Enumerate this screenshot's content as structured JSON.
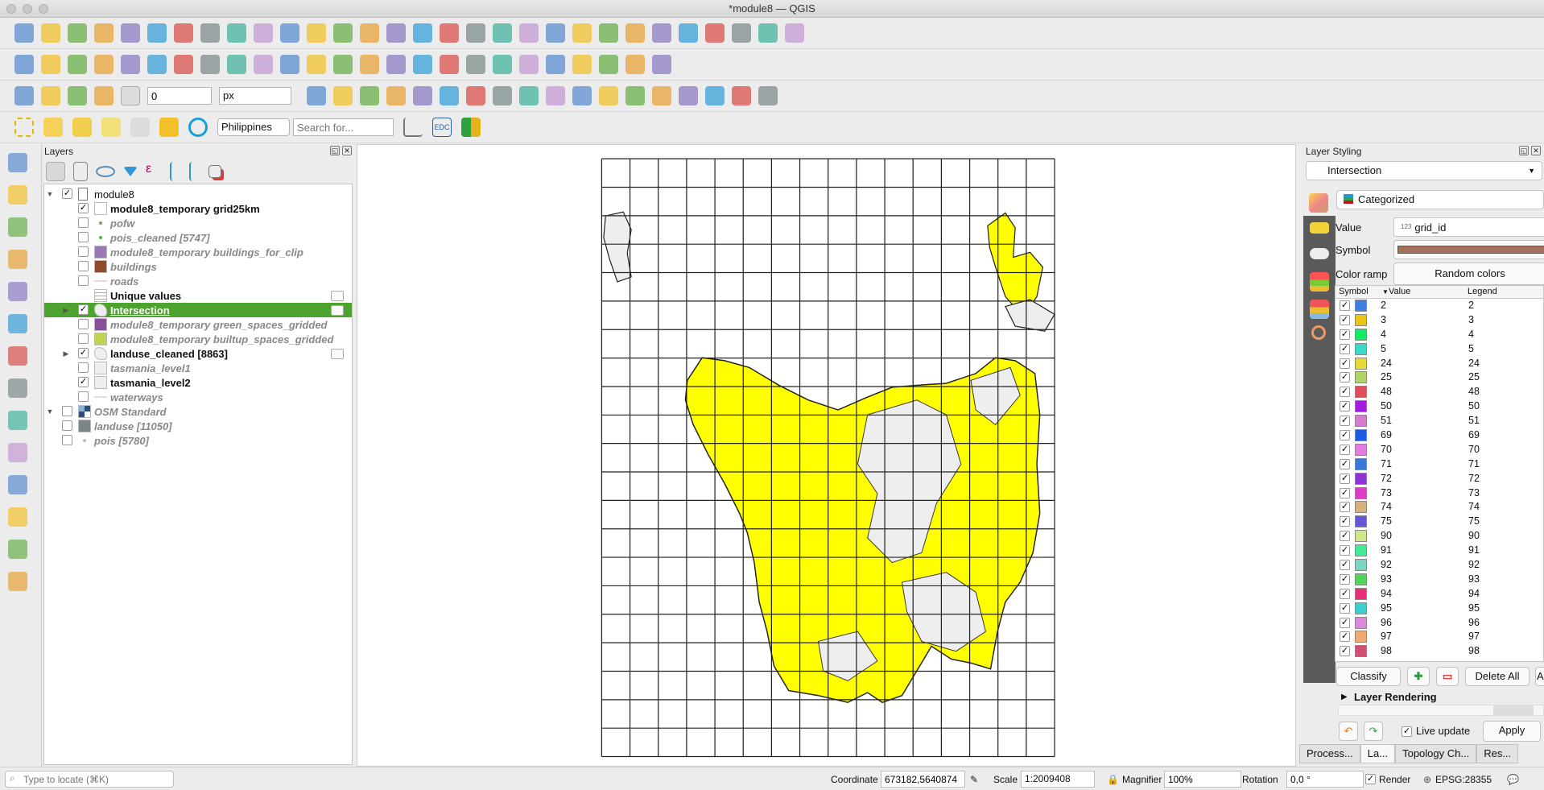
{
  "window": {
    "title": "*module8 — QGIS"
  },
  "toolbar": {
    "row1_icons": [
      "new-project",
      "open-project",
      "save-project",
      "save-as",
      "new-print-layout",
      "layout-manager",
      "pan",
      "pan-to-selection",
      "zoom-in",
      "zoom-out",
      "zoom-full",
      "zoom-to-selection",
      "zoom-to-layer",
      "zoom-native",
      "zoom-last",
      "zoom-next",
      "new-map-view",
      "new-3d-view",
      "new-bookmark",
      "show-bookmarks",
      "temporal",
      "refresh",
      "identify",
      "attribute-table",
      "statistics",
      "sum",
      "measure",
      "map-tips",
      "select",
      "text-annotation"
    ],
    "row2_icons": [
      "edit-pencil",
      "toggle-editing",
      "save-edits",
      "digitize",
      "delete",
      "cut",
      "copy",
      "paste",
      "undo",
      "redo",
      "add-vector",
      "add-raster",
      "vertex-tool",
      "add-feature",
      "label-tool",
      "pin-labels",
      "show-labels",
      "move-label",
      "rotate-label",
      "change-label",
      "database",
      "hexagon",
      "web-services",
      "plugin",
      "python"
    ],
    "row3_icons": [
      "trace",
      "advanced-digitize",
      "snap",
      "magnet"
    ],
    "snapping_tolerance": "0",
    "snapping_unit": "px",
    "locator_country": "Philippines",
    "search_placeholder": "Search for...",
    "edc_label": "EDC",
    "row3_right_icons": [
      "python-console",
      "grid",
      "world",
      "gps",
      "layers",
      "qgis-plugin",
      "triangulate",
      "refresh-plugin",
      "ref-plugin",
      "grid-plugin",
      "3d",
      "table",
      "pca",
      "binoculars",
      "info",
      "photo",
      "openeo",
      "map"
    ]
  },
  "left_toolbar": [
    "new-vector-layer",
    "add-xyz-layer",
    "add-mesh-layer",
    "add-delimited-text",
    "add-spatialite",
    "add-virtual-layer",
    "add-postgis",
    "add-wms",
    "add-wfs",
    "add-wcs",
    "add-geopackage",
    "gps-tool",
    "georeferencer",
    "crosshair"
  ],
  "layers_panel": {
    "title": "Layers",
    "items": [
      {
        "label": "module8",
        "level": 0,
        "checked": true,
        "expander": "down",
        "style": "normal",
        "swatch": "group"
      },
      {
        "label": "module8_temporary grid25km",
        "level": 1,
        "checked": true,
        "style": "bold",
        "swatch": "#ffffff"
      },
      {
        "label": "pofw",
        "level": 1,
        "checked": false,
        "style": "italic",
        "swatch": "dot",
        "dot_color": "#7aa06a"
      },
      {
        "label": "pois_cleaned [5747]",
        "level": 1,
        "checked": false,
        "style": "italic",
        "swatch": "dot",
        "dot_color": "#4bb34b"
      },
      {
        "label": "module8_temporary buildings_for_clip",
        "level": 1,
        "checked": false,
        "style": "italic",
        "swatch": "#9b79b7"
      },
      {
        "label": "buildings",
        "level": 1,
        "checked": false,
        "style": "italic",
        "swatch": "#8e4a2b"
      },
      {
        "label": "roads",
        "level": 1,
        "checked": false,
        "style": "italic",
        "swatch": "line",
        "line_color": "#e8d8cf"
      },
      {
        "label": "Unique values",
        "level": 1,
        "checked": null,
        "style": "bold",
        "swatch": "table",
        "right_icon": "embedded"
      },
      {
        "label": "Intersection",
        "level": 1,
        "checked": true,
        "expander": "right",
        "style": "selected",
        "swatch": "polygon",
        "right_icon": "embedded"
      },
      {
        "label": "module8_temporary green_spaces_gridded",
        "level": 1,
        "checked": false,
        "style": "italic",
        "swatch": "#8a4f9a"
      },
      {
        "label": "module8_temporary builtup_spaces_gridded",
        "level": 1,
        "checked": false,
        "style": "italic",
        "swatch": "#c3d152"
      },
      {
        "label": "landuse_cleaned [8863]",
        "level": 1,
        "checked": true,
        "expander": "right",
        "style": "bold",
        "swatch": "polygon",
        "right_icon": "filter"
      },
      {
        "label": "tasmania_level1",
        "level": 1,
        "checked": false,
        "style": "italic",
        "swatch": "#eeeeee"
      },
      {
        "label": "tasmania_level2",
        "level": 1,
        "checked": true,
        "style": "bold",
        "swatch": "#eeeeee"
      },
      {
        "label": "waterways",
        "level": 1,
        "checked": false,
        "style": "italic",
        "swatch": "line",
        "line_color": "#e6d8e6"
      },
      {
        "label": "OSM Standard",
        "level": 0,
        "checked": false,
        "expander": "down",
        "style": "italic",
        "swatch": "raster"
      },
      {
        "label": "landuse [11050]",
        "level": 0,
        "checked": false,
        "style": "italic",
        "swatch": "#7b858a"
      },
      {
        "label": "pois [5780]",
        "level": 0,
        "checked": false,
        "style": "italic",
        "swatch": "dot",
        "dot_color": "#bbbbbb"
      }
    ]
  },
  "map": {
    "grid_columns": 16,
    "grid_rows": 21,
    "land_color": "#ffff00",
    "other_color": "#eeeeee"
  },
  "layer_styling": {
    "title": "Layer Styling",
    "layer": "Intersection",
    "renderer": "Categorized",
    "value_label": "Value",
    "value_type": "123",
    "value": "grid_id",
    "symbol_label": "Symbol",
    "symbol_color": "#a3705a",
    "color_ramp_label": "Color ramp",
    "color_ramp": "Random colors",
    "columns": [
      "Symbol",
      "Value",
      "Legend"
    ],
    "categories": [
      {
        "value": "2",
        "legend": "2",
        "color": "#3f7fe0"
      },
      {
        "value": "3",
        "legend": "3",
        "color": "#ecc31b"
      },
      {
        "value": "4",
        "legend": "4",
        "color": "#14ea62"
      },
      {
        "value": "5",
        "legend": "5",
        "color": "#3bdac6"
      },
      {
        "value": "24",
        "legend": "24",
        "color": "#e6d93a"
      },
      {
        "value": "25",
        "legend": "25",
        "color": "#acd46a"
      },
      {
        "value": "48",
        "legend": "48",
        "color": "#e04e5c"
      },
      {
        "value": "50",
        "legend": "50",
        "color": "#a31be0"
      },
      {
        "value": "51",
        "legend": "51",
        "color": "#d37ecc"
      },
      {
        "value": "69",
        "legend": "69",
        "color": "#1d5ae0"
      },
      {
        "value": "70",
        "legend": "70",
        "color": "#e27ee0"
      },
      {
        "value": "71",
        "legend": "71",
        "color": "#3a78d8"
      },
      {
        "value": "72",
        "legend": "72",
        "color": "#8e34d4"
      },
      {
        "value": "73",
        "legend": "73",
        "color": "#dc3cc2"
      },
      {
        "value": "74",
        "legend": "74",
        "color": "#d9b080"
      },
      {
        "value": "75",
        "legend": "75",
        "color": "#6455da"
      },
      {
        "value": "90",
        "legend": "90",
        "color": "#cde88c"
      },
      {
        "value": "91",
        "legend": "91",
        "color": "#44ea94"
      },
      {
        "value": "92",
        "legend": "92",
        "color": "#7ed6c2"
      },
      {
        "value": "93",
        "legend": "93",
        "color": "#55d25c"
      },
      {
        "value": "94",
        "legend": "94",
        "color": "#e72d7c"
      },
      {
        "value": "95",
        "legend": "95",
        "color": "#3ecdd0"
      },
      {
        "value": "96",
        "legend": "96",
        "color": "#dc86e0"
      },
      {
        "value": "97",
        "legend": "97",
        "color": "#eeab76"
      },
      {
        "value": "98",
        "legend": "98",
        "color": "#d24e72"
      }
    ],
    "classify": "Classify",
    "delete_all": "Delete All",
    "advanced": "Ad",
    "layer_rendering": "Layer Rendering",
    "live_update": "Live update",
    "apply": "Apply"
  },
  "dock_tabs": [
    {
      "label": "Process...",
      "active": false
    },
    {
      "label": "La...",
      "active": true
    },
    {
      "label": "Topology Ch...",
      "active": false
    },
    {
      "label": "Res...",
      "active": false
    }
  ],
  "statusbar": {
    "locate_placeholder": "Type to locate (⌘K)",
    "coordinate_label": "Coordinate",
    "coordinate": "673182,5640874",
    "scale_label": "Scale",
    "scale": "1:2009408",
    "magnifier_label": "Magnifier",
    "magnifier": "100%",
    "rotation_label": "Rotation",
    "rotation": "0,0 °",
    "render_label": "Render",
    "crs": "EPSG:28355"
  }
}
